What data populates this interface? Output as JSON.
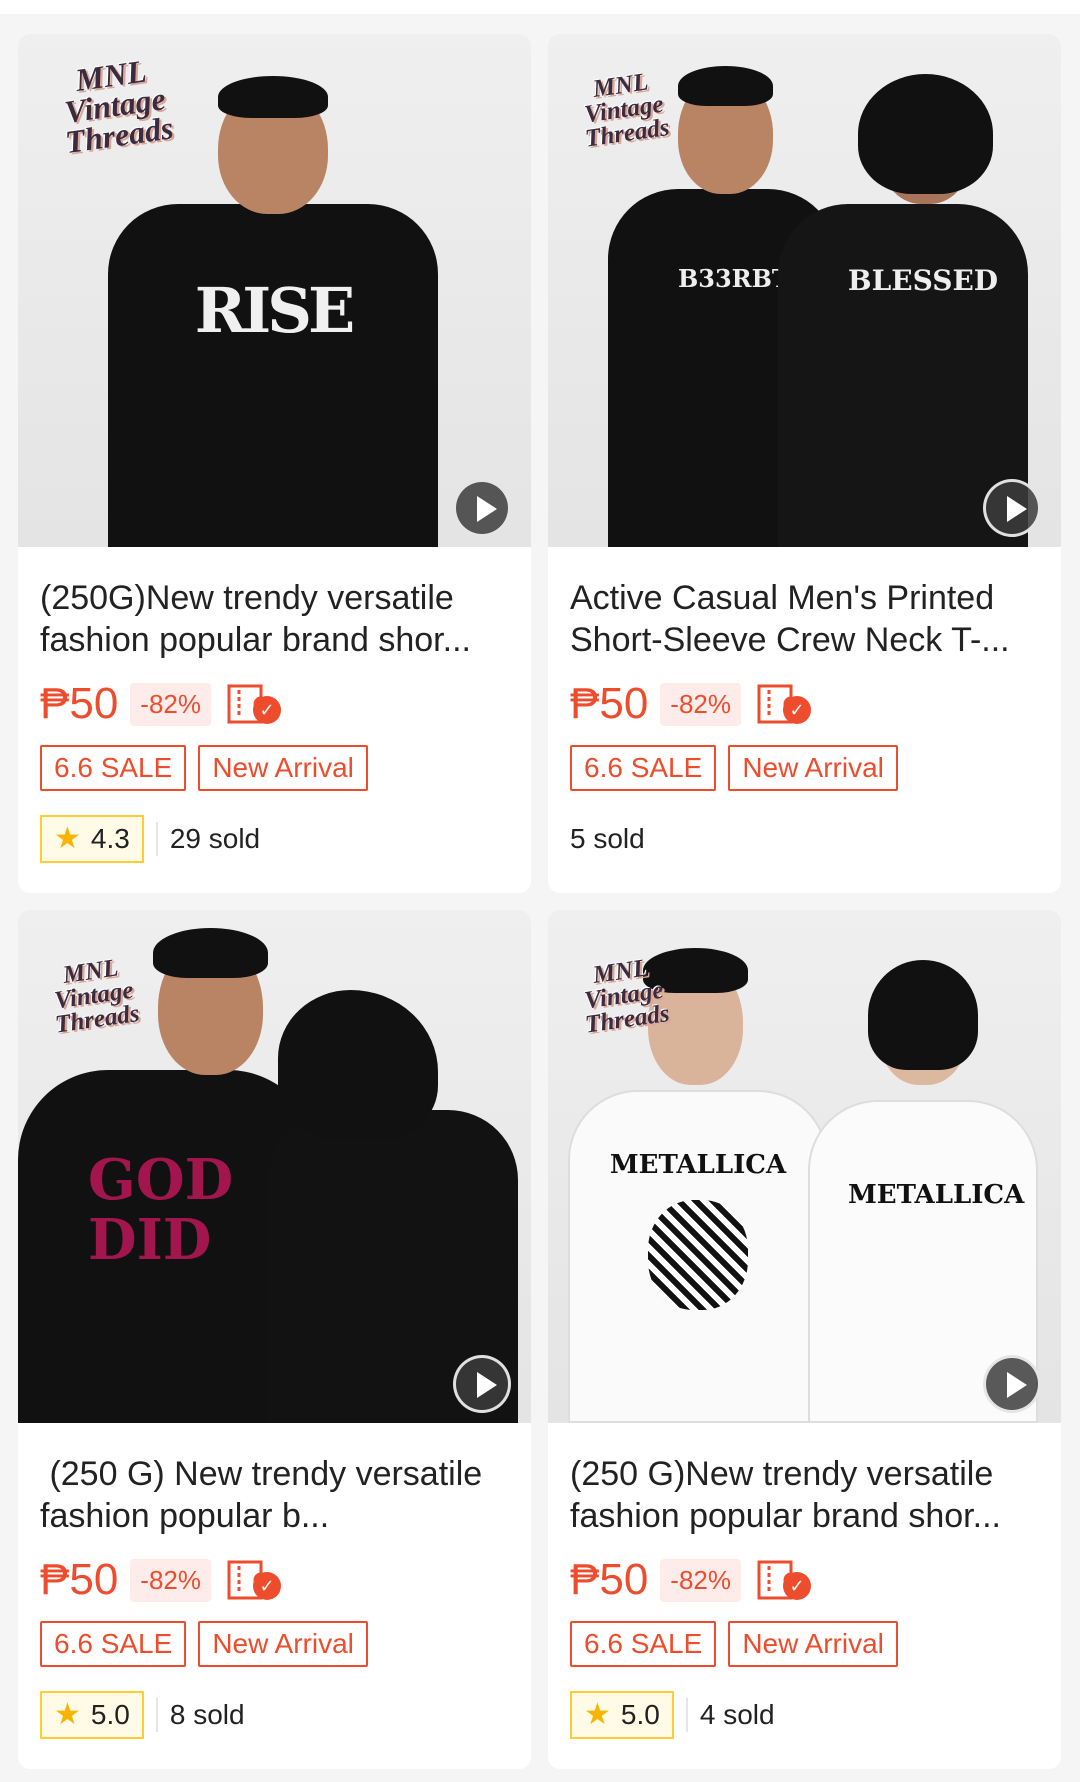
{
  "colors": {
    "accent": "#ee4d2d",
    "rating_border": "#ffcc33",
    "star": "#f7b500"
  },
  "brand_logo": [
    "MNL",
    "Vintage",
    "Threads"
  ],
  "products": [
    {
      "title": "(250G)New trendy versatile fashion popular brand shor...",
      "price": "₱50",
      "discount": "-82%",
      "tags": [
        "6.6 SALE",
        "New Arrival"
      ],
      "rating": "4.3",
      "sold": "29 sold",
      "shirt_print": "RISE",
      "shirt_color": "#111111",
      "has_video": true
    },
    {
      "title": "Active Casual Men's Printed Short-Sleeve Crew Neck T-...",
      "price": "₱50",
      "discount": "-82%",
      "tags": [
        "6.6 SALE",
        "New Arrival"
      ],
      "rating": null,
      "sold": "5 sold",
      "shirt_print": "BLESSED",
      "shirt_color": "#111111",
      "has_video": true
    },
    {
      "title": " (250 G) New trendy versatile fashion popular b...",
      "price": "₱50",
      "discount": "-82%",
      "tags": [
        "6.6 SALE",
        "New Arrival"
      ],
      "rating": "5.0",
      "sold": "8 sold",
      "shirt_print": "GOD DID",
      "shirt_color": "#111111",
      "has_video": true
    },
    {
      "title": "(250 G)New trendy versatile fashion popular brand shor...",
      "price": "₱50",
      "discount": "-82%",
      "tags": [
        "6.6 SALE",
        "New Arrival"
      ],
      "rating": "5.0",
      "sold": "4 sold",
      "shirt_print": "METALLICA",
      "shirt_color": "#ffffff",
      "has_video": true
    }
  ]
}
